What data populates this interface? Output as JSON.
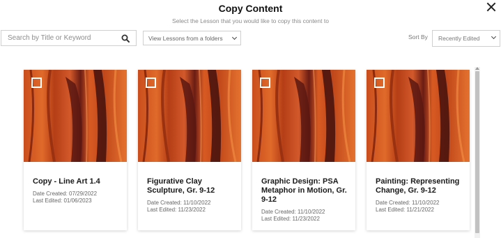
{
  "header": {
    "title": "Copy Content",
    "subtitle": "Select the Lesson that you would like to copy this content to"
  },
  "toolbar": {
    "search_placeholder": "Search by Title or Keyword",
    "folder_select_value": "View Lessons from a folders",
    "sort_label": "Sort By",
    "sort_value": "Recently Edited"
  },
  "lessons": [
    {
      "title": "Copy - Line Art 1.4",
      "created": "Date Created: 07/29/2022",
      "edited": "Last Edited: 01/06/2023"
    },
    {
      "title": "Figurative Clay Sculpture, Gr. 9-12",
      "created": "Date Created: 11/10/2022",
      "edited": "Last Edited: 11/23/2022"
    },
    {
      "title": "Graphic Design: PSA Metaphor in Motion, Gr. 9-12",
      "created": "Date Created: 11/10/2022",
      "edited": "Last Edited: 11/23/2022"
    },
    {
      "title": "Painting: Representing Change, Gr. 9-12",
      "created": "Date Created: 11/10/2022",
      "edited": "Last Edited: 11/21/2022"
    }
  ],
  "icons": {
    "close": "close-icon",
    "search": "search-icon",
    "dropdown": "chevron-down-icon",
    "checkbox": "checkbox-icon"
  }
}
